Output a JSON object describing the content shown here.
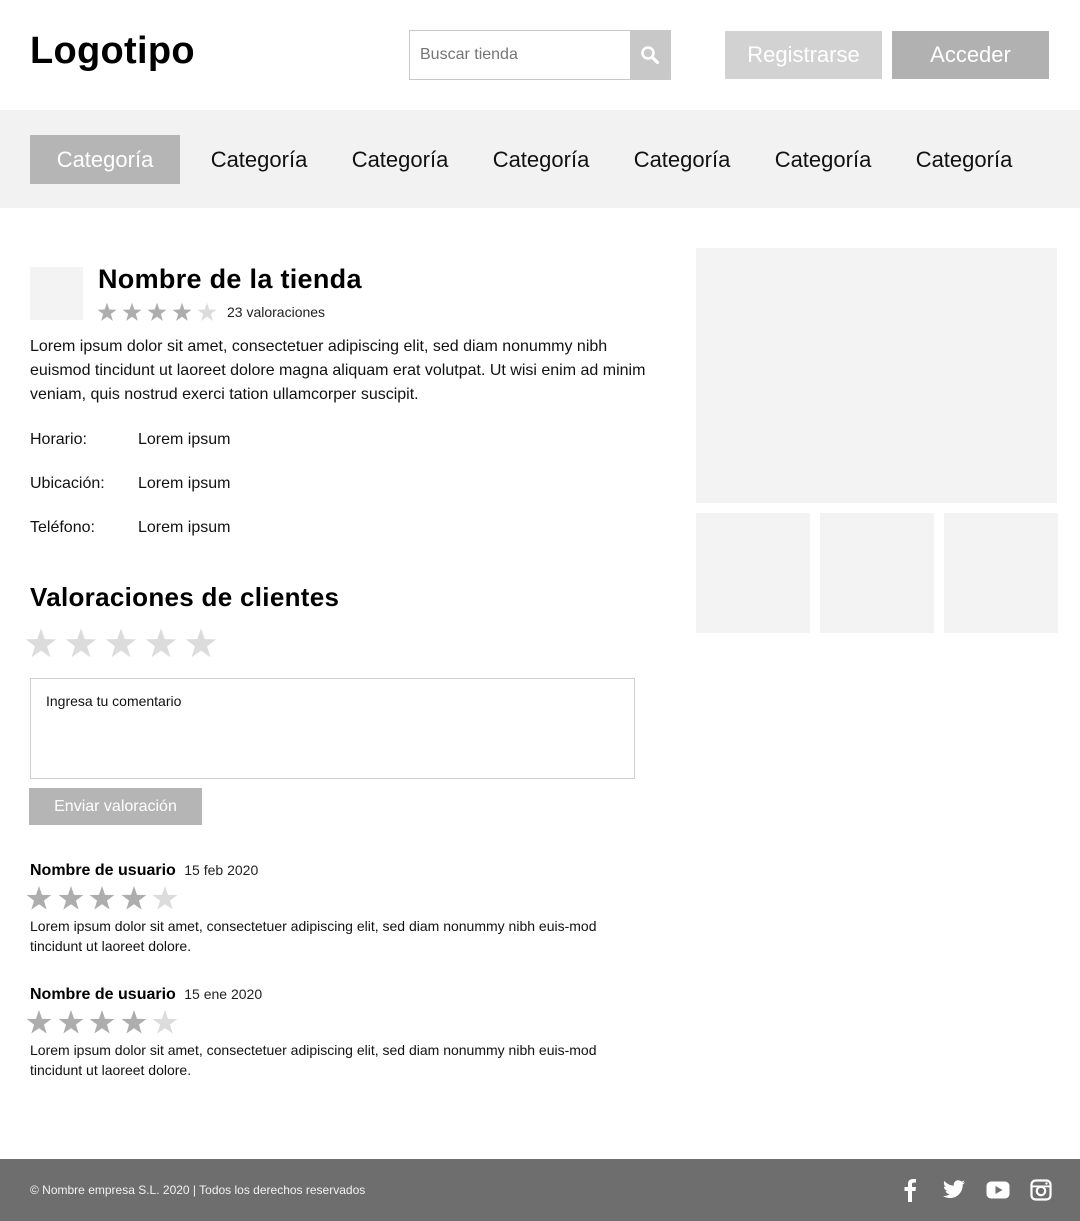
{
  "header": {
    "logo": "Logotipo",
    "search_placeholder": "Buscar tienda",
    "register_label": "Registrarse",
    "login_label": "Acceder"
  },
  "nav": {
    "items": [
      "Categoría",
      "Categoría",
      "Categoría",
      "Categoría",
      "Categoría",
      "Categoría",
      "Categoría"
    ],
    "active_index": 0
  },
  "store": {
    "name": "Nombre de la tienda",
    "rating": 4,
    "rating_max": 5,
    "rating_count": "23 valoraciones",
    "description": "Lorem ipsum dolor sit amet, consectetuer adipiscing elit, sed diam nonummy nibh euismod tincidunt ut laoreet dolore magna aliquam erat volutpat. Ut wisi enim ad minim veniam, quis nostrud exerci tation ullamcorper suscipit.",
    "info": [
      {
        "label": "Horario:",
        "value": "Lorem ipsum"
      },
      {
        "label": "Ubicación:",
        "value": "Lorem ipsum"
      },
      {
        "label": "Teléfono:",
        "value": "Lorem ipsum"
      }
    ]
  },
  "reviews": {
    "title": "Valoraciones de clientes",
    "input_stars_selected": 0,
    "comment_placeholder": "Ingresa tu comentario",
    "submit_label": "Enviar valoración",
    "items": [
      {
        "user": "Nombre de usuario",
        "date": "15 feb 2020",
        "rating": 4,
        "text": "Lorem ipsum dolor sit amet, consectetuer adipiscing elit, sed diam nonummy nibh euis-mod tincidunt ut laoreet dolore."
      },
      {
        "user": "Nombre de usuario",
        "date": "15 ene 2020",
        "rating": 4,
        "text": "Lorem ipsum dolor sit amet, consectetuer adipiscing elit, sed diam nonummy nibh euis-mod tincidunt ut laoreet dolore."
      }
    ]
  },
  "footer": {
    "copyright": "© Nombre empresa S.L. 2020 | Todos los derechos reservados",
    "social_icons": [
      "facebook-icon",
      "twitter-icon",
      "youtube-icon",
      "instagram-icon"
    ]
  },
  "colors": {
    "star_filled": "#adadad",
    "star_empty": "#dcdcdc",
    "accent_gray": "#b5b5b5",
    "footer_bg": "#6e6e6e",
    "placeholder_bg": "#f3f3f3"
  }
}
